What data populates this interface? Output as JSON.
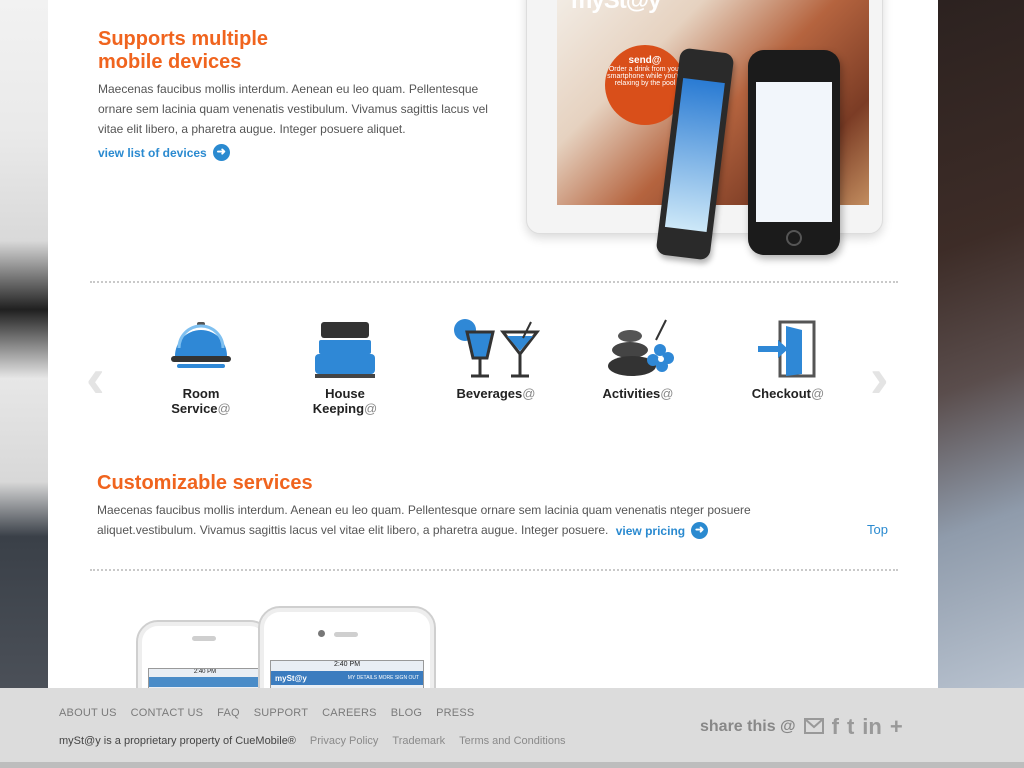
{
  "devices": {
    "heading_line1": "Supports multiple",
    "heading_line2": "mobile devices",
    "body": "Maecenas faucibus mollis interdum. Aenean eu leo quam. Pellentesque ornare sem lacinia quam venenatis vestibulum. Vivamus sagittis lacus vel vitae elit libero, a pharetra augue. Integer posuere aliquet.",
    "link": "view list of devices"
  },
  "tablet": {
    "brand": "mySt@y",
    "bubble_title": "send@",
    "bubble_text": "Order a drink from your smartphone while you're relaxing by the pool"
  },
  "services": [
    {
      "line1": "Room",
      "line2": "Service",
      "suffix": "@",
      "icon": "room-service-cloche-icon"
    },
    {
      "line1": "House",
      "line2": "Keeping",
      "suffix": "@",
      "icon": "bed-icon"
    },
    {
      "line1": "Beverages",
      "line2": "",
      "suffix": "@",
      "icon": "cocktail-icon"
    },
    {
      "line1": "Activities",
      "line2": "",
      "suffix": "@",
      "icon": "spa-stones-icon"
    },
    {
      "line1": "Checkout",
      "line2": "",
      "suffix": "@",
      "icon": "exit-door-icon"
    }
  ],
  "customizable": {
    "heading": "Customizable services",
    "body": "Maecenas faucibus mollis interdum. Aenean eu leo quam. Pellentesque ornare sem lacinia quam venenatis nteger posuere aliquet.vestibulum. Vivamus sagittis lacus vel vitae elit libero, a pharetra augue. Integer posuere.",
    "link": "view pricing",
    "top": "Top"
  },
  "phones": {
    "time": "2:40 PM",
    "brand": "mySt@y",
    "menu": "MY DETAILS   MORE   SIGN OUT"
  },
  "footer": {
    "nav": [
      "ABOUT US",
      "CONTACT US",
      "FAQ",
      "SUPPORT",
      "CAREERS",
      "BLOG",
      "PRESS"
    ],
    "copyright": "mySt@y is a proprietary property of CueMobile®",
    "legal_links": [
      "Privacy Policy",
      "Trademark",
      "Terms and Conditions"
    ],
    "share_label": "share this @"
  },
  "colors": {
    "accent_orange": "#f0641e",
    "link_blue": "#2a8ad0"
  }
}
